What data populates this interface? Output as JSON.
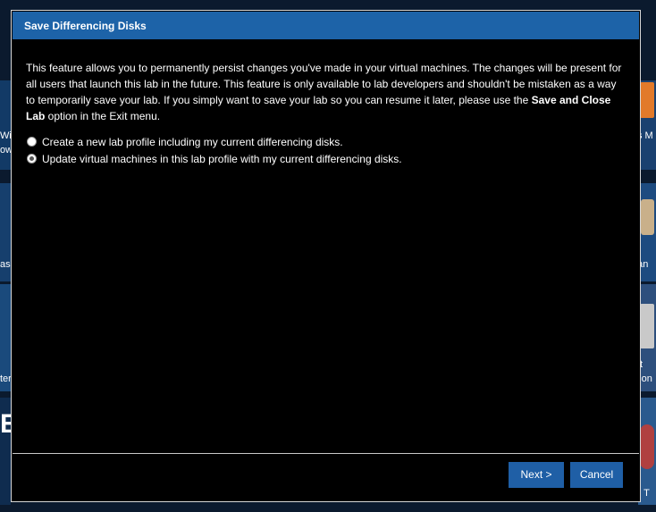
{
  "dialog": {
    "title": "Save Differencing Disks",
    "description_before": "This feature allows you to permanently persist changes you've made in your virtual machines. The changes will be present for all users that launch this lab in the future. This feature is only available to lab developers and shouldn't be mistaken as a way to temporarily save your lab. If you simply want to save your lab so you can resume it later, please use the ",
    "description_bold": "Save and Close Lab",
    "description_after": " option in the Exit menu.",
    "options": [
      {
        "label": "Create a new lab profile including my current differencing disks.",
        "selected": false
      },
      {
        "label": "Update virtual machines in this lab profile with my current differencing disks.",
        "selected": true
      }
    ],
    "next_label": "Next >",
    "cancel_label": "Cancel"
  },
  "background": {
    "left_fragments": [
      "Win",
      "ow",
      "ask",
      "ter",
      "E"
    ],
    "right_fragments": [
      "ws M",
      "ean",
      "t",
      "ation",
      "ng T"
    ]
  },
  "colors": {
    "titlebar": "#1d63a8",
    "dialog_bg": "#000000",
    "button_bg": "#1f5fa6"
  }
}
